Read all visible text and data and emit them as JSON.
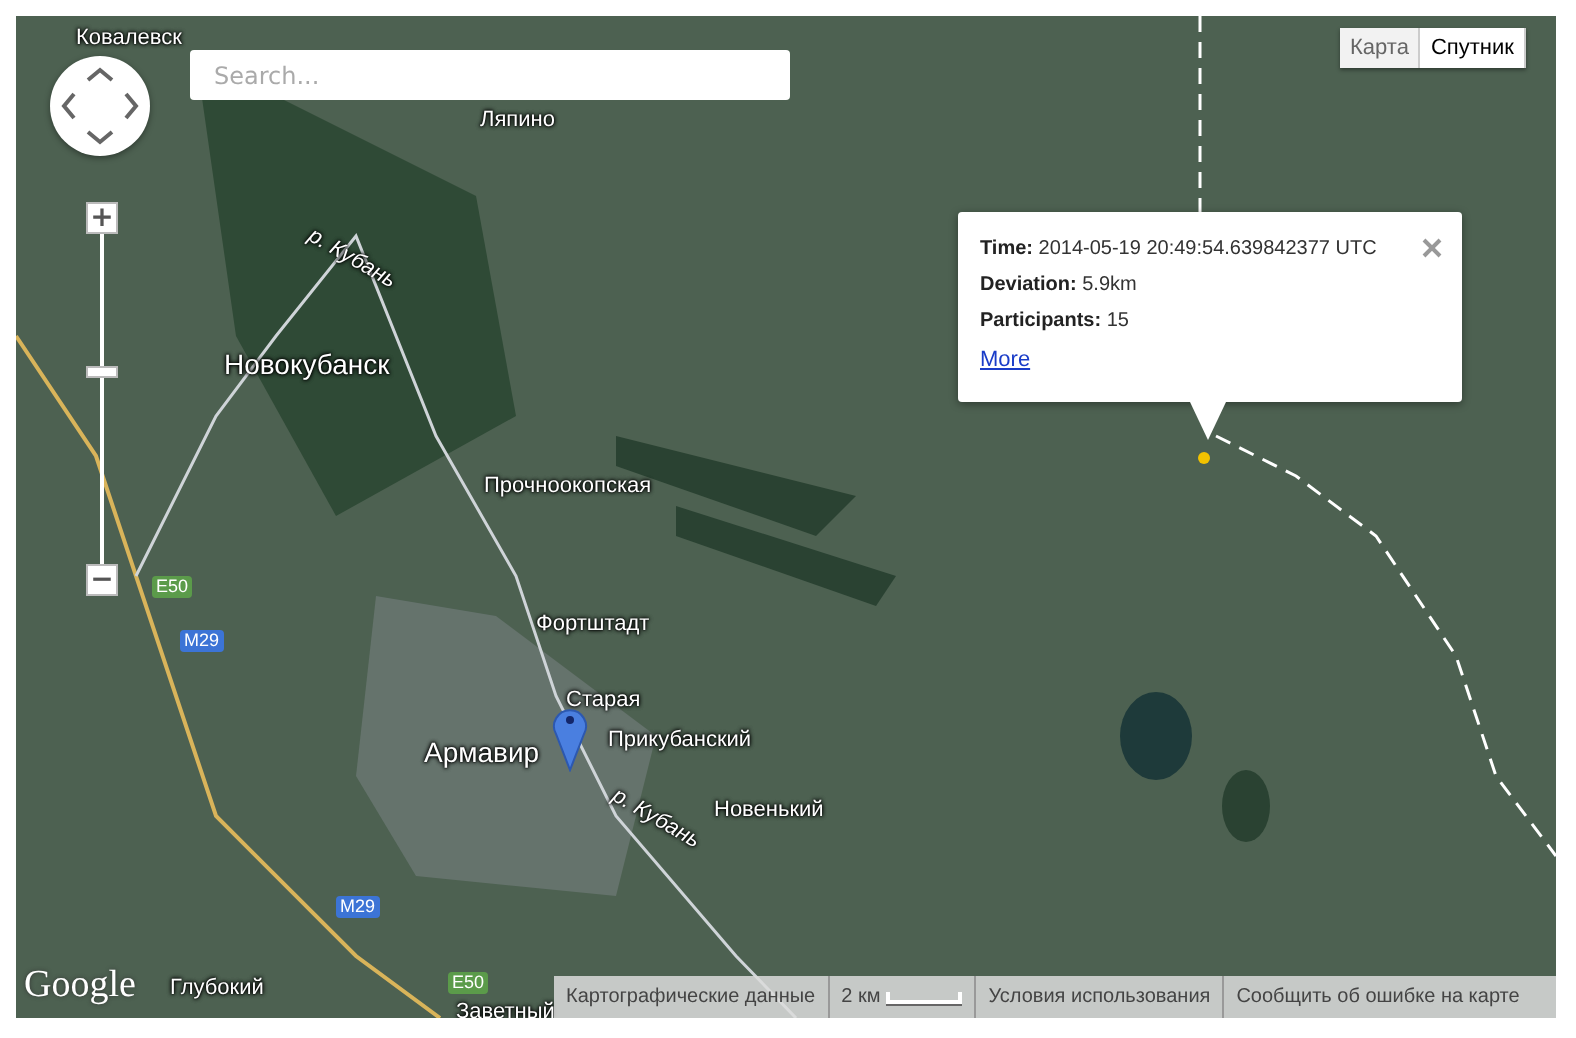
{
  "search": {
    "placeholder": "Search..."
  },
  "zoom": {
    "plus": "+",
    "minus": "−",
    "level": 0.58
  },
  "map_type": [
    {
      "label": "Карта",
      "selected": false
    },
    {
      "label": "Спутник",
      "selected": true
    }
  ],
  "map_labels": [
    {
      "text": "Ковалевск",
      "kind": "place"
    },
    {
      "text": "Ляпино",
      "kind": "place"
    },
    {
      "text": "р. Кубань",
      "kind": "river"
    },
    {
      "text": "Новокубанск",
      "kind": "city"
    },
    {
      "text": "Прочноокопская",
      "kind": "place"
    },
    {
      "text": "Фортштадт",
      "kind": "place"
    },
    {
      "text": "Старая",
      "kind": "place"
    },
    {
      "text": "Прикубанский",
      "kind": "place"
    },
    {
      "text": "Армавир",
      "kind": "city"
    },
    {
      "text": "р. Кубань",
      "kind": "river"
    },
    {
      "text": "Новенький",
      "kind": "place"
    },
    {
      "text": "Глубокий",
      "kind": "place"
    },
    {
      "text": "Заветный",
      "kind": "place"
    },
    {
      "text": "E50",
      "kind": "shield_e"
    },
    {
      "text": "M29",
      "kind": "shield_m"
    },
    {
      "text": "M29",
      "kind": "shield_m"
    },
    {
      "text": "E50",
      "kind": "shield_e"
    }
  ],
  "info_window": {
    "fields": [
      {
        "label": "Time:",
        "value": "2014-05-19 20:49:54.639842377 UTC"
      },
      {
        "label": "Deviation:",
        "value": "5.9km"
      },
      {
        "label": "Participants:",
        "value": "15"
      }
    ],
    "link": "More"
  },
  "logo": "Google",
  "attribution": {
    "map_data": "Картографические данные",
    "scale": "2 км",
    "terms": "Условия использования",
    "report": "Сообщить об ошибке на карте"
  }
}
